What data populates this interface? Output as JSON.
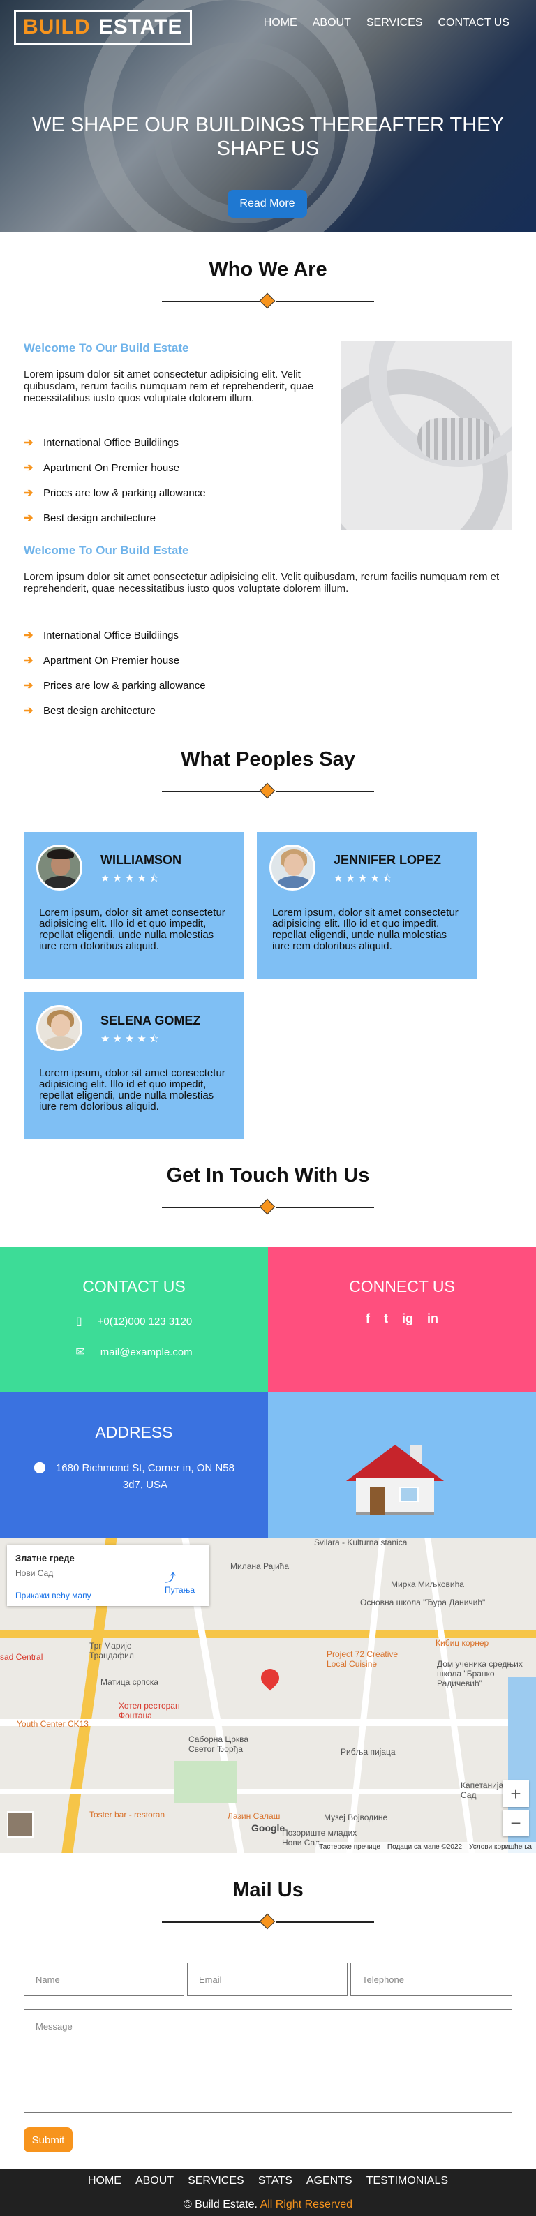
{
  "header": {
    "logo_part1": "BUILD",
    "logo_part2": "ESTATE",
    "nav": [
      "HOME",
      "ABOUT",
      "SERVICES",
      "CONTACT US"
    ]
  },
  "hero": {
    "headline": "WE SHAPE OUR BUILDINGS THEREAFTER THEY SHAPE US",
    "button": "Read More"
  },
  "about": {
    "heading": "Who We Are",
    "block1_title": "Welcome To Our Build Estate",
    "block1_text": "Lorem ipsum dolor sit amet consectetur adipisicing elit. Velit quibusdam, rerum facilis numquam rem et reprehenderit, quae necessitatibus iusto quos voluptate dolorem illum.",
    "block2_title": "Welcome To Our Build Estate",
    "block2_text": "Lorem ipsum dolor sit amet consectetur adipisicing elit. Velit quibusdam, rerum facilis numquam rem et reprehenderit, quae necessitatibus iusto quos voluptate dolorem illum.",
    "features": [
      "International Office Buildiings",
      "Apartment On Premier house",
      "Prices are low & parking allowance",
      "Best design architecture"
    ]
  },
  "testimonials": {
    "heading": "What Peoples Say",
    "items": [
      {
        "name": "WILLIAMSON",
        "stars": "★★★★⯪",
        "text": "Lorem ipsum, dolor sit amet consectetur adipisicing elit. Illo id et quo impedit, repellat eligendi, unde nulla molestias iure rem doloribus aliquid."
      },
      {
        "name": "JENNIFER LOPEZ",
        "stars": "★★★★⯪",
        "text": "Lorem ipsum, dolor sit amet consectetur adipisicing elit. Illo id et quo impedit, repellat eligendi, unde nulla molestias iure rem doloribus aliquid."
      },
      {
        "name": "SELENA GOMEZ",
        "stars": "★★★★⯪",
        "text": "Lorem ipsum, dolor sit amet consectetur adipisicing elit. Illo id et quo impedit, repellat eligendi, unde nulla molestias iure rem doloribus aliquid."
      }
    ]
  },
  "contact": {
    "heading": "Get In Touch With Us",
    "contact_title": "CONTACT US",
    "phone": "+0(12)000 123 3120",
    "email": "mail@example.com",
    "connect_title": "CONNECT US",
    "social": [
      "f",
      "t",
      "ig",
      "in"
    ],
    "address_title": "ADDRESS",
    "address": "1680 Richmond St, Corner in, ON N58 3d7, USA",
    "colors": {
      "contact": "#3ddc97",
      "connect": "#ff4f7e",
      "address": "#3a72e0",
      "house_bg": "#7fbff4"
    }
  },
  "map": {
    "place": "Златне греде",
    "city": "Нови Сад",
    "directions": "Путања",
    "larger_map": "Прикажи већу мапу",
    "labels": [
      "Svilara - Kulturna stanica",
      "Милана Рајића",
      "Мирка Миљковића",
      "Основна школа \"Ђура Даничић\"",
      "Кибиц корнер",
      "Дом ученика средњих школа \"Бранко Радичевић\"",
      "Project 72 Creative Local Cuisine",
      "Трг Марије Трандафил",
      "Матица српска",
      "Хотел ресторан Фонтана",
      "Саборна Црква Светог Ђорђа",
      "Рибља пијаца",
      "Youth Center CK13",
      "Toster bar - restoran",
      "Лазин Салаш",
      "Музеј Војводине",
      "Капетанија Нови Сад",
      "Позориште младих Нови Сад",
      "sad Central"
    ],
    "footer": [
      "Тастерске пречице",
      "Подаци са мапе ©2022",
      "Услови коришћења"
    ],
    "zoom_in": "+",
    "zoom_out": "−",
    "google": "Google"
  },
  "mail": {
    "heading": "Mail Us",
    "name_ph": "Name",
    "email_ph": "Email",
    "phone_ph": "Telephone",
    "message_ph": "Message",
    "submit": "Submit"
  },
  "footer": {
    "nav": [
      "HOME",
      "ABOUT",
      "SERVICES",
      "STATS",
      "AGENTS",
      "TESTIMONIALS"
    ],
    "copy_main": "© Build Estate.",
    "copy_hl": "All Right Reserved"
  }
}
